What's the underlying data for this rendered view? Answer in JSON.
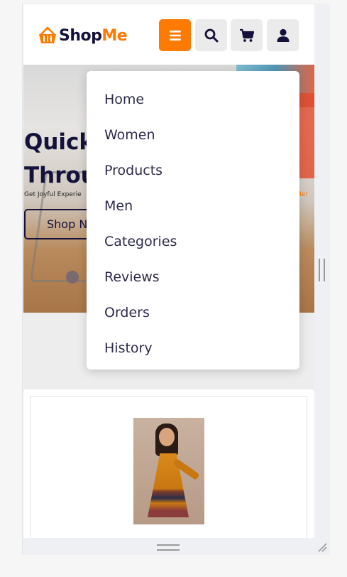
{
  "brand": {
    "name_part1": "Shop",
    "name_part2": "Me",
    "accent": "#ff7a00",
    "dark": "#14123a"
  },
  "header": {
    "icons": [
      "basket-icon",
      "hamburger-icon",
      "search-icon",
      "cart-icon",
      "user-icon"
    ]
  },
  "hero": {
    "title_line1": "Quick",
    "title_line2": "Throu",
    "subtitle": "Get Joyful Experie",
    "subtitle_tail": "Me!",
    "button_label": "Shop N"
  },
  "menu": {
    "items": [
      {
        "label": "Home"
      },
      {
        "label": "Women"
      },
      {
        "label": "Products"
      },
      {
        "label": "Men"
      },
      {
        "label": "Categories"
      },
      {
        "label": "Reviews"
      },
      {
        "label": "Orders"
      },
      {
        "label": "History"
      }
    ]
  }
}
